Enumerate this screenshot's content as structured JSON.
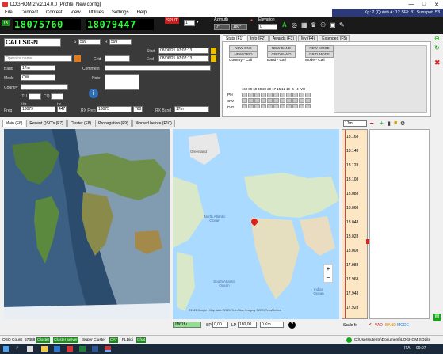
{
  "window": {
    "title": "LOGHOM 2 v.2.14.0.0 [Profile: New config]",
    "controls": [
      "—",
      "□",
      "✕"
    ]
  },
  "menu": [
    "File",
    "Connect",
    "Contest",
    "View",
    "Utilities",
    "Settings",
    "Help"
  ],
  "solar": {
    "text": "Kp: 2 (Quiet)  A: 12  SFI: 81  Sunspot: 53"
  },
  "toolbar": {
    "vfo_a_label": "TX",
    "vfo_a": "18075760",
    "vfo_b": "18079447",
    "split_label": "SPLIT",
    "step_value": "1",
    "azimuth_label": "Azimuth",
    "azimuth_values": [
      "0°",
      "180°"
    ],
    "elevation_label": "Elevation",
    "elevation_value": "0"
  },
  "qso": {
    "callsign": "CALLSIGN",
    "s_label": "S",
    "s_value": "599",
    "r_label": "R",
    "r_value": "599",
    "operator_placeholder": "Operator name",
    "grid_label": "Grid",
    "start_label": "Start",
    "start_value": "08/06/21 07:07:13",
    "end_label": "End",
    "end_value": "08/06/21 07:07:13",
    "band_label": "Band",
    "band_value": "17m",
    "comment_label": "Comment",
    "mode_label": "Mode",
    "mode_value": "CW",
    "note_label": "Note",
    "country_label": "Country",
    "itu_label": "ITU",
    "cq_label": "CQ",
    "freq_label": "Freq",
    "freq_khz_label": "KHz",
    "freq_hz_label": "Hz",
    "freq_value": "18079",
    "freq_hz_value": "447",
    "rxfreq_label": "RX Freq",
    "rxfreq_value": "18075",
    "rxfreq_hz_value": "760",
    "rxband_label": "RX Band",
    "rxband_value": "17m"
  },
  "stat_tabs": [
    "Stats (F1)",
    "Info (F2)",
    "Awards (F3)",
    "My (F4)",
    "Extended (F5)"
  ],
  "stats": {
    "btns": [
      "NEW ONE",
      "NEW GRID",
      "NEW BAND",
      "GRID BAND",
      "NEW MODE",
      "GRID MODE"
    ],
    "col_labels": [
      "Country - Call",
      "Band - Call",
      "Mode - Call"
    ],
    "bands_header": "160 80 60 40 30 20 17 15 12 10  6   4  VU",
    "rows": [
      "PH",
      "CW",
      "DIG"
    ]
  },
  "main_tabs": [
    "Main (F6)",
    "Recent QSO's (F7)",
    "Cluster (F8)",
    "Propagation (F9)",
    "Worked before (F10)"
  ],
  "map": {
    "labels": [
      "Greenland",
      "North Atlantic Ocean",
      "South Atlantic Ocean",
      "Indian Ocean"
    ],
    "attribution": "©2021 Google - Map data ©2021 Tele Atlas, Imagery ©2021 TerraMetrics",
    "locator": "JN61fu",
    "sp_label": "SP",
    "sp_value": "0,00",
    "lp_label": "LP",
    "lp_value": "180,00",
    "km_value": "0 Km"
  },
  "bandmap": {
    "band": "17m",
    "ticks": [
      "18.168",
      "18.148",
      "18.128",
      "18.108",
      "18.088",
      "18.068",
      "18.048",
      "18.028",
      "18.008",
      "17.988",
      "17.968",
      "17.948",
      "17.928"
    ],
    "scale_label": "Scale  fx",
    "mode_tags": [
      "VAD",
      "BAND",
      "MODE"
    ]
  },
  "status": {
    "qso_count_label": "QSO Count",
    "qso_count": "57388",
    "tags": [
      "Cluster",
      "Cluster server",
      "Super Cluster",
      "CAT",
      "FLDigi",
      "Chat"
    ],
    "db_path": "C:\\Users\\utente\\Documenti\\LOGHOM.SQLite"
  },
  "taskbar": {
    "time": "09:07",
    "lang": "ITA"
  },
  "colors": {
    "vfo": "#2eff3a",
    "toolbar": "#1a1a1a",
    "panel": "#3a3a3a",
    "band": "#fde6c4",
    "green_tag": "#1e8a1e"
  }
}
